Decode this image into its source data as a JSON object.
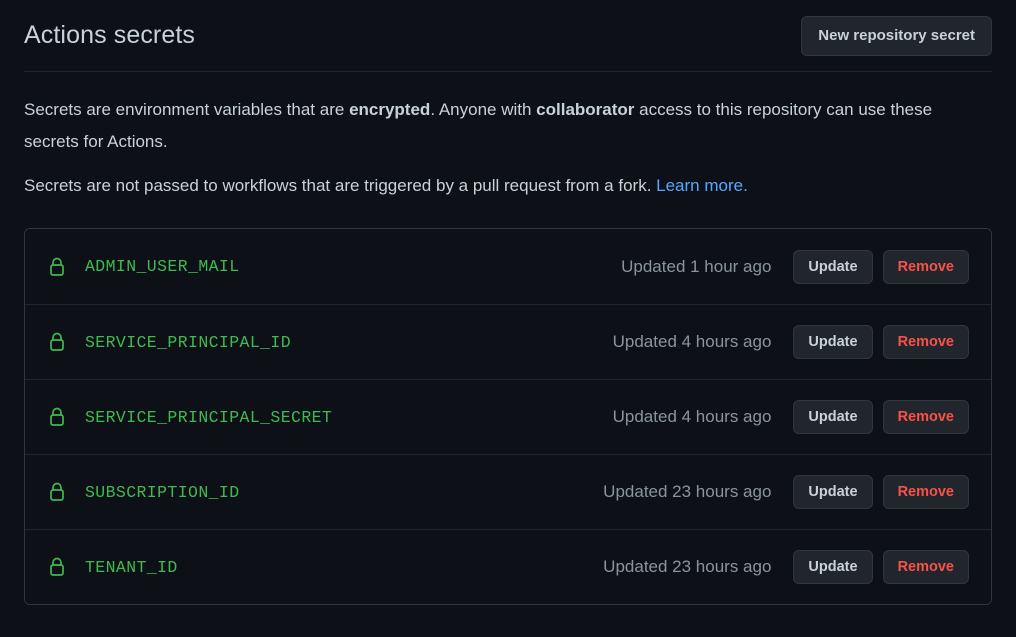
{
  "header": {
    "title": "Actions secrets",
    "new_secret_button": "New repository secret"
  },
  "description": {
    "para1_part1": "Secrets are environment variables that are ",
    "para1_bold1": "encrypted",
    "para1_part2": ". Anyone with ",
    "para1_bold2": "collaborator",
    "para1_part3": " access to this repository can use these secrets for Actions.",
    "para2_part1": "Secrets are not passed to workflows that are triggered by a pull request from a fork. ",
    "para2_link": "Learn more",
    "para2_part2": "."
  },
  "icons": {
    "lock": "lock-icon"
  },
  "colors": {
    "page_background": "#0d1117",
    "border": "#30363d",
    "row_divider": "#21262d",
    "text_primary": "#c9d1d9",
    "text_muted": "#8b949e",
    "secret_green": "#3fb950",
    "link_blue": "#58a6ff",
    "danger_red": "#f85149",
    "button_background": "#21262d"
  },
  "buttons": {
    "update_label": "Update",
    "remove_label": "Remove"
  },
  "secrets": [
    {
      "name": "ADMIN_USER_MAIL",
      "updated": "Updated 1 hour ago"
    },
    {
      "name": "SERVICE_PRINCIPAL_ID",
      "updated": "Updated 4 hours ago"
    },
    {
      "name": "SERVICE_PRINCIPAL_SECRET",
      "updated": "Updated 4 hours ago"
    },
    {
      "name": "SUBSCRIPTION_ID",
      "updated": "Updated 23 hours ago"
    },
    {
      "name": "TENANT_ID",
      "updated": "Updated 23 hours ago"
    }
  ]
}
